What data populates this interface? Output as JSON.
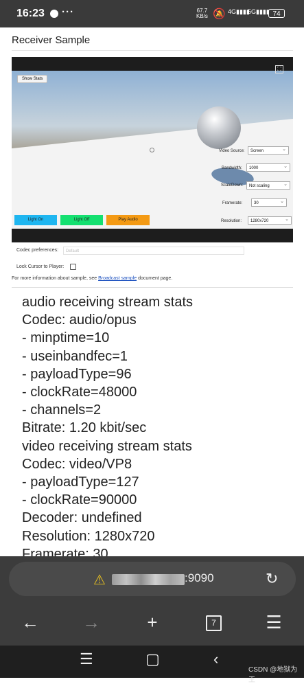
{
  "status_bar": {
    "time": "16:23",
    "more": "···",
    "speed_value": "67.7",
    "speed_unit": "KB/s",
    "network_4g": "4G",
    "network_5g": "5G",
    "battery": "74"
  },
  "page": {
    "title": "Receiver Sample"
  },
  "player": {
    "show_stats_label": "Show Stats",
    "video_source_label": "Video Source:",
    "video_source_value": "Screen",
    "bandwidth_label": "Bandwidth:",
    "bandwidth_value": "1000",
    "scaledown_label": "ScaleDown:",
    "scaledown_value": "Not scaling",
    "framerate_label": "Framerate:",
    "framerate_value": "30",
    "resolution_label": "Resolution:",
    "resolution_value": "1280x720",
    "buttons": {
      "light_on": "Light On",
      "light_off": "Light Off",
      "play_audio": "Play Audio"
    },
    "button_colors": {
      "light_on": "#1fb6f0",
      "light_off": "#14e070",
      "play_audio": "#f49a14"
    }
  },
  "controls": {
    "codec_label": "Codec preferences:",
    "codec_value": "Default",
    "lock_cursor_label": "Lock Cursor to Player:",
    "info_prefix": "For more information about sample, see",
    "info_link": "Broadcast sample",
    "info_suffix": "document page."
  },
  "stats_lines": [
    "audio receiving stream stats",
    "Codec: audio/opus",
    "- minptime=10",
    "- useinbandfec=1",
    "- payloadType=96",
    "- clockRate=48000",
    "- channels=2",
    "Bitrate: 1.20 kbit/sec",
    "video receiving stream stats",
    "Codec: video/VP8",
    "- payloadType=127",
    "- clockRate=90000",
    "Decoder: undefined",
    "Resolution: 1280x720",
    "Framerate: 30"
  ],
  "browser": {
    "url_visible": ":9090",
    "tab_count": "7",
    "icons": [
      "warning-icon",
      "reload-icon",
      "back-arrow-icon",
      "forward-arrow-icon",
      "plus-icon",
      "tabs-icon",
      "menu-icon"
    ]
  },
  "system_nav": {
    "watermark": "CSDN @地狱为王"
  }
}
